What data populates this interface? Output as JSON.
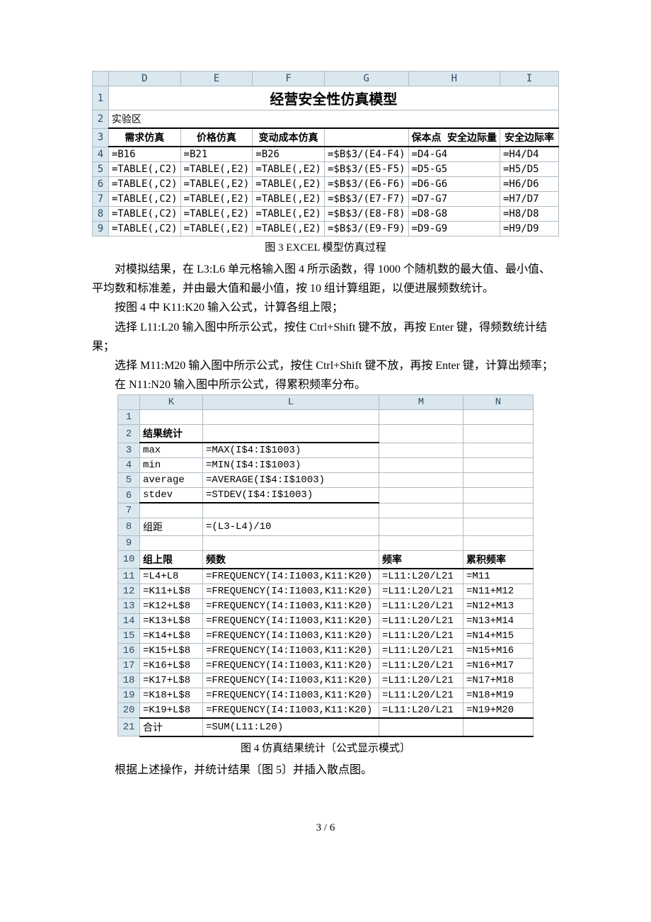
{
  "fig3": {
    "cols": [
      "D",
      "E",
      "F",
      "G",
      "H",
      "I"
    ],
    "title": "经营安全性仿真模型",
    "section": "实验区",
    "headers": {
      "D": "需求仿真",
      "E": "价格仿真",
      "F": "变动成本仿真",
      "G": "",
      "H": "保本点 安全边际量",
      "I": "安全边际率"
    },
    "rows": [
      [
        "4",
        "=B16",
        "=B21",
        "=B26",
        "=$B$3/(E4-F4)",
        "=D4-G4",
        "=H4/D4"
      ],
      [
        "5",
        "=TABLE(,C2)",
        "=TABLE(,E2)",
        "=TABLE(,E2)",
        "=$B$3/(E5-F5)",
        "=D5-G5",
        "=H5/D5"
      ],
      [
        "6",
        "=TABLE(,C2)",
        "=TABLE(,E2)",
        "=TABLE(,E2)",
        "=$B$3/(E6-F6)",
        "=D6-G6",
        "=H6/D6"
      ],
      [
        "7",
        "=TABLE(,C2)",
        "=TABLE(,E2)",
        "=TABLE(,E2)",
        "=$B$3/(E7-F7)",
        "=D7-G7",
        "=H7/D7"
      ],
      [
        "8",
        "=TABLE(,C2)",
        "=TABLE(,E2)",
        "=TABLE(,E2)",
        "=$B$3/(E8-F8)",
        "=D8-G8",
        "=H8/D8"
      ],
      [
        "9",
        "=TABLE(,C2)",
        "=TABLE(,E2)",
        "=TABLE(,E2)",
        "=$B$3/(E9-F9)",
        "=D9-G9",
        "=H9/D9"
      ]
    ],
    "caption": "图 3 EXCEL 模型仿真过程"
  },
  "paragraphs": {
    "p1": "对模拟结果，在 L3:L6 单元格输入图 4 所示函数，得 1000 个随机数的最大值、最小值、平均数和标准差，并由最大值和最小值，按 10 组计算组距，以便进展频数统计。",
    "p2": "按图 4 中 K11:K20 输入公式，计算各组上限；",
    "p3": "选择 L11:L20 输入图中所示公式，按住 Ctrl+Shift 键不放，再按 Enter 键，得频数统计结果；",
    "p4": "选择 M11:M20 输入图中所示公式，按住 Ctrl+Shift 键不放，再按 Enter 键，计算出频率；",
    "p5": "在 N11:N20 输入图中所示公式，得累积频率分布。"
  },
  "fig4": {
    "cols": [
      "K",
      "L",
      "M",
      "N"
    ],
    "rows_pre": [
      [
        "1",
        "",
        "",
        "",
        ""
      ],
      [
        "2",
        "结果统计",
        "",
        "",
        ""
      ],
      [
        "3",
        "max",
        "=MAX(I$4:I$1003)",
        "",
        ""
      ],
      [
        "4",
        "min",
        "=MIN(I$4:I$1003)",
        "",
        ""
      ],
      [
        "5",
        "average",
        "=AVERAGE(I$4:I$1003)",
        "",
        ""
      ],
      [
        "6",
        "stdev",
        "=STDEV(I$4:I$1003)",
        "",
        ""
      ],
      [
        "7",
        "",
        "",
        "",
        ""
      ],
      [
        "8",
        "组距",
        "=(L3-L4)/10",
        "",
        ""
      ],
      [
        "9",
        "",
        "",
        "",
        ""
      ]
    ],
    "header10": [
      "10",
      "组上限",
      "频数",
      "频率",
      "累积频率"
    ],
    "rows_data": [
      [
        "11",
        "=L4+L8",
        "=FREQUENCY(I4:I1003,K11:K20)",
        "=L11:L20/L21",
        "=M11"
      ],
      [
        "12",
        "=K11+L$8",
        "=FREQUENCY(I4:I1003,K11:K20)",
        "=L11:L20/L21",
        "=N11+M12"
      ],
      [
        "13",
        "=K12+L$8",
        "=FREQUENCY(I4:I1003,K11:K20)",
        "=L11:L20/L21",
        "=N12+M13"
      ],
      [
        "14",
        "=K13+L$8",
        "=FREQUENCY(I4:I1003,K11:K20)",
        "=L11:L20/L21",
        "=N13+M14"
      ],
      [
        "15",
        "=K14+L$8",
        "=FREQUENCY(I4:I1003,K11:K20)",
        "=L11:L20/L21",
        "=N14+M15"
      ],
      [
        "16",
        "=K15+L$8",
        "=FREQUENCY(I4:I1003,K11:K20)",
        "=L11:L20/L21",
        "=N15+M16"
      ],
      [
        "17",
        "=K16+L$8",
        "=FREQUENCY(I4:I1003,K11:K20)",
        "=L11:L20/L21",
        "=N16+M17"
      ],
      [
        "18",
        "=K17+L$8",
        "=FREQUENCY(I4:I1003,K11:K20)",
        "=L11:L20/L21",
        "=N17+M18"
      ],
      [
        "19",
        "=K18+L$8",
        "=FREQUENCY(I4:I1003,K11:K20)",
        "=L11:L20/L21",
        "=N18+M19"
      ],
      [
        "20",
        "=K19+L$8",
        "=FREQUENCY(I4:I1003,K11:K20)",
        "=L11:L20/L21",
        "=N19+M20"
      ],
      [
        "21",
        "合计",
        "=SUM(L11:L20)",
        "",
        ""
      ]
    ],
    "caption": "图 4 仿真结果统计〔公式显示模式〕"
  },
  "p_after": "根据上述操作，并统计结果〔图 5〕并插入散点图。",
  "footer": "3 / 6"
}
